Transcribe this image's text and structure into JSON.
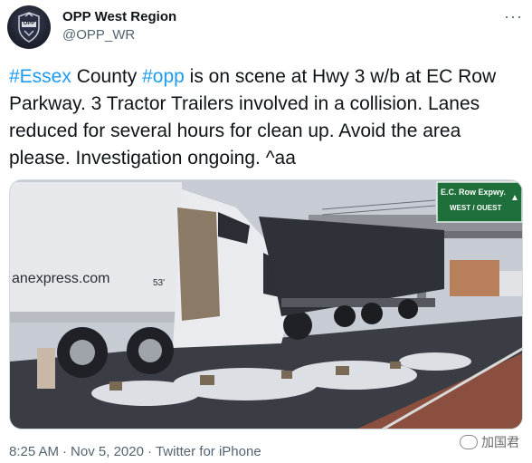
{
  "account": {
    "name": "OPP West Region",
    "handle": "@OPP_WR",
    "badge_text": "OPP"
  },
  "tweet": {
    "segments": [
      {
        "text": "#Essex",
        "hashtag": true
      },
      {
        "text": " County ",
        "hashtag": false
      },
      {
        "text": "#opp",
        "hashtag": true
      },
      {
        "text": " is on scene at Hwy 3 w/b at EC Row Parkway. 3 Tractor Trailers involved in a collision. Lanes reduced for several hours for clean up. Avoid the area please. Investigation ongoing.  ^aa",
        "hashtag": false
      }
    ]
  },
  "photo": {
    "sign_line1": "E.C. Row Expwy.",
    "sign_line2": "WEST / OUEST",
    "trailer_text": "anexpress.com",
    "trailer_number": "53'"
  },
  "meta": {
    "time": "8:25 AM",
    "date": "Nov 5, 2020",
    "source": "Twitter for iPhone",
    "separator": "·"
  },
  "watermark": {
    "text": "加国君"
  },
  "more_label": "···",
  "colors": {
    "hashtag": "#1d9bf0",
    "secondary_text": "#536471",
    "sign_green": "#1f6f3a"
  }
}
